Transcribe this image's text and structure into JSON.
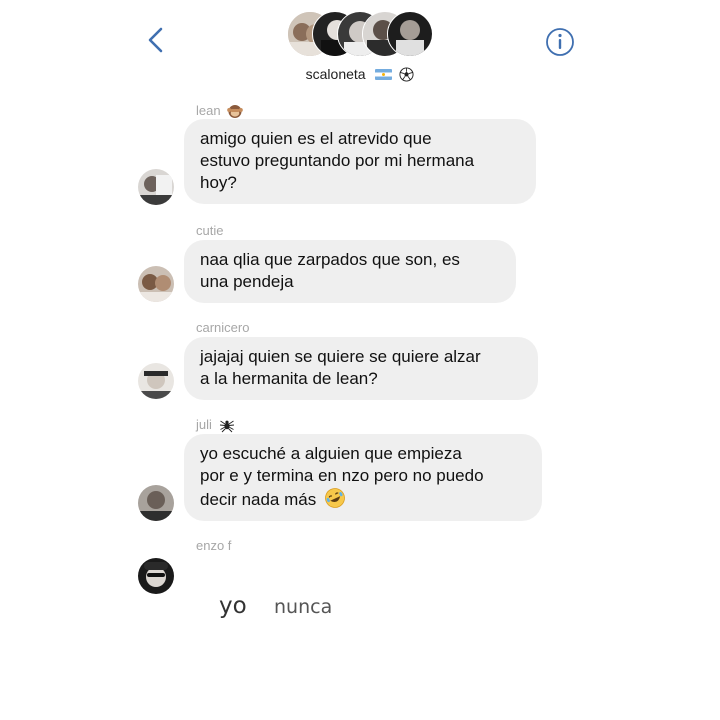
{
  "header": {
    "back_icon": "chevron-left-icon",
    "info_icon": "info-circle-icon",
    "group_name": "scaloneta",
    "group_name_emojis": [
      "argentina-flag",
      "soccer-ball"
    ],
    "accent_color": "#3f6fb0"
  },
  "messages": [
    {
      "sender": "lean",
      "sender_emoji": "monkey-face",
      "text_lines": [
        "amigo quien es el atrevido que",
        "estuvo preguntando por mi hermana",
        "hoy?"
      ]
    },
    {
      "sender": "cutie",
      "text_lines": [
        "naa qlia que zarpados que son, es",
        "una pendeja"
      ]
    },
    {
      "sender": "carnicero",
      "text_lines": [
        "jajajaj quien se quiere se quiere alzar",
        "a la hermanita de lean?"
      ]
    },
    {
      "sender": "juli",
      "sender_emoji": "spider",
      "text_lines": [
        "yo escuché a alguien que empieza",
        "por e y termina en nzo pero no puedo",
        "decir nada más"
      ],
      "trailing_emoji": "rolling-laughing-face"
    },
    {
      "sender": "enzo f",
      "handwritten": [
        "yo",
        "nunca"
      ]
    }
  ]
}
